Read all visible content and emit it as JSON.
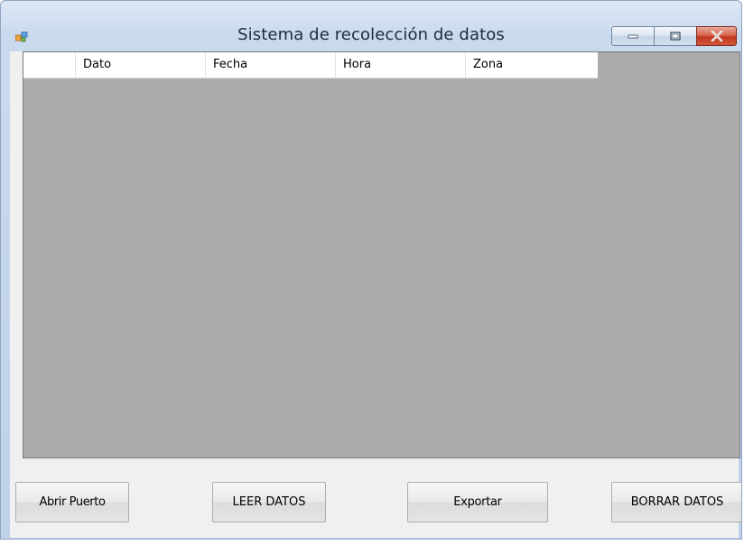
{
  "window": {
    "title": "Sistema de recolección de datos",
    "icon": "application-icon",
    "controls": {
      "minimize": "minimize-icon",
      "maximize": "maximize-icon",
      "close": "close-icon"
    }
  },
  "grid": {
    "columns": [
      "Dato",
      "Fecha",
      "Hora",
      "Zona"
    ],
    "rows": []
  },
  "buttons": {
    "abrir_puerto": "Abrir Puerto",
    "leer_datos": "LEER DATOS",
    "exportar": "Exportar",
    "borrar_datos": "BORRAR DATOS"
  },
  "colors": {
    "grid_background": "#ababab",
    "close_button": "#c0371f"
  }
}
